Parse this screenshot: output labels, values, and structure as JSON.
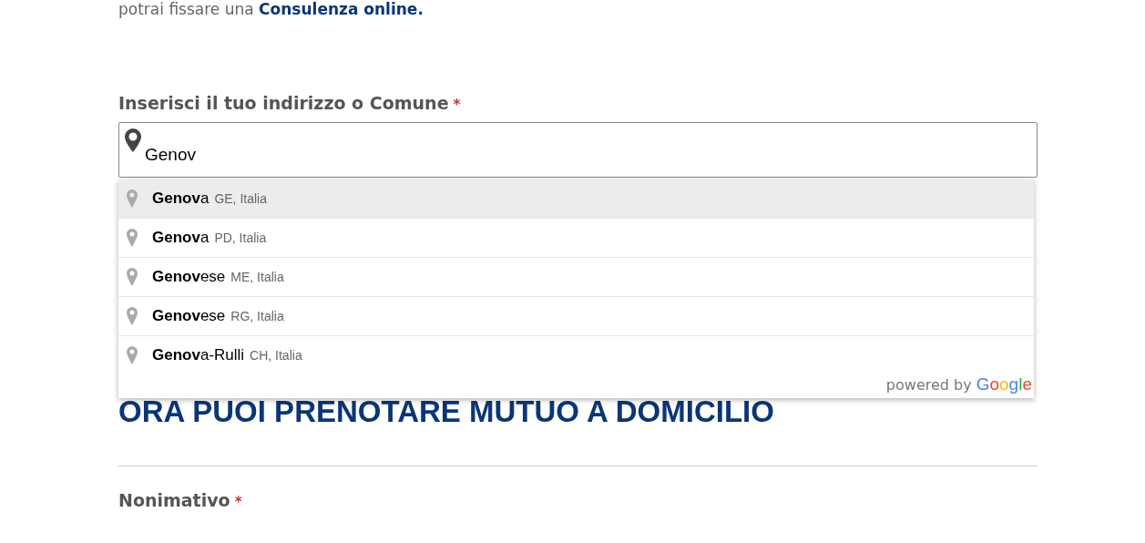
{
  "intro": "potrai fissare una **Consulenza online.**",
  "address_field": {
    "label": "Inserisci il tuo indirizzo o Comune",
    "required_mark": "*",
    "value": "Genov"
  },
  "suggestions": [
    {
      "main": "**Genov**a",
      "secondary": "GE, Italia",
      "selected": true
    },
    {
      "main": "**Genov**a",
      "secondary": "PD, Italia",
      "selected": false
    },
    {
      "main": "**Genov**ese",
      "secondary": "ME, Italia",
      "selected": false
    },
    {
      "main": "**Genov**ese",
      "secondary": "RG, Italia",
      "selected": false
    },
    {
      "main": "**Genov**a-Rulli",
      "secondary": "CH, Italia",
      "selected": false
    }
  ],
  "attribution": {
    "text": "powered by",
    "logo": "Google"
  },
  "heading": "ORA PUOI PRENOTARE MUTUO A DOMICILIO",
  "name_field": {
    "label": "Nonimativo",
    "required_mark": "*"
  }
}
